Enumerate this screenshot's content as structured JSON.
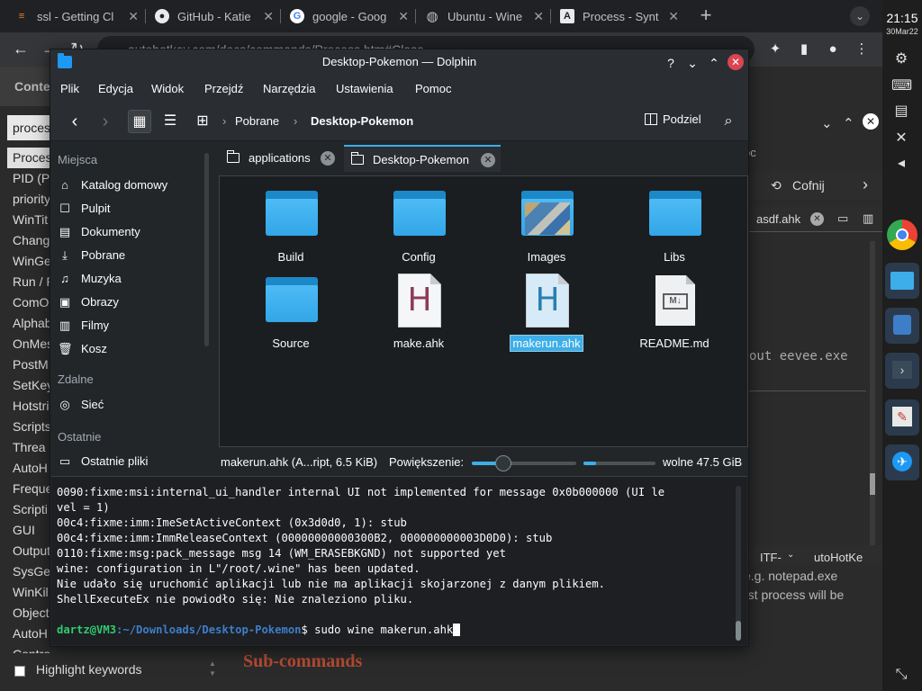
{
  "browser": {
    "tabs": [
      {
        "title": "ssl - Getting Cl",
        "icon": "stackoverflow-icon"
      },
      {
        "title": "GitHub - Katie",
        "icon": "github-icon"
      },
      {
        "title": "google - Goog",
        "icon": "google-icon"
      },
      {
        "title": "Ubuntu - Wine",
        "icon": "globe-icon"
      },
      {
        "title": "Process - Synt",
        "icon": "autohotkey-icon"
      }
    ],
    "url": "autohotkey.com/docs/commands/Process.htm#Close"
  },
  "webpage": {
    "left_header": "Conte",
    "search_value": "proces",
    "list": [
      "Proces",
      "PID (P",
      "priority",
      "WinTit",
      "Chang",
      "WinGe",
      "Run / R",
      "ComO",
      "Alphab",
      "OnMes",
      "PostM",
      "SetKey",
      "Hotstri",
      "Scripts",
      "Threa",
      "AutoH",
      "Freque",
      "Scripti",
      "GUI",
      "Output",
      "SysGe",
      "WinKil",
      "Object",
      "AutoH",
      "ControlGet"
    ],
    "highlight_label": "Highlight keywords",
    "subcommands": "Sub-commands",
    "right": {
      "oc": "oc",
      "undo": "Cofnij",
      "file_tab": "asdf.ahk",
      "code": "out eevee.exe",
      "encoding": "ITF-",
      "app": "utoHotKe",
      "doc1": "e.g. notepad.exe",
      "doc2": "rst process will be"
    }
  },
  "shelf": {
    "time": "21:15",
    "date": "30Mar22"
  },
  "dolphin": {
    "title": "Desktop-Pokemon — Dolphin",
    "menu": [
      "Plik",
      "Edycja",
      "Widok",
      "Przejdź",
      "Narzędzia",
      "Ustawienia",
      "Pomoc"
    ],
    "breadcrumb": [
      "Pobrane",
      "Desktop-Pokemon"
    ],
    "split_label": "Podziel",
    "places": {
      "group1": "Miejsca",
      "items1": [
        "Katalog domowy",
        "Pulpit",
        "Dokumenty",
        "Pobrane",
        "Muzyka",
        "Obrazy",
        "Filmy",
        "Kosz"
      ],
      "group2": "Zdalne",
      "items2": [
        "Sieć"
      ],
      "group3": "Ostatnie",
      "items3": [
        "Ostatnie pliki"
      ]
    },
    "view_tabs": [
      "applications",
      "Desktop-Pokemon"
    ],
    "files": [
      {
        "name": "Build",
        "type": "folder"
      },
      {
        "name": "Config",
        "type": "folder"
      },
      {
        "name": "Images",
        "type": "image-folder"
      },
      {
        "name": "Libs",
        "type": "folder"
      },
      {
        "name": "Source",
        "type": "folder"
      },
      {
        "name": "make.ahk",
        "type": "ahk"
      },
      {
        "name": "makerun.ahk",
        "type": "ahk",
        "selected": true
      },
      {
        "name": "README.md",
        "type": "markdown"
      }
    ],
    "status": {
      "selection": "makerun.ahk (A...ript, 6.5 KiB)",
      "zoom_label": "Powiększenie:",
      "zoom_level": 0.3,
      "disk_used": 0.18,
      "free": "wolne 47.5 GiB"
    },
    "terminal": {
      "lines": [
        "0090:fixme:msi:internal_ui_handler internal UI not implemented for message 0x0b000000 (UI le",
        "vel = 1)",
        "00c4:fixme:imm:ImeSetActiveContext (0x3d0d0, 1): stub",
        "00c4:fixme:imm:ImmReleaseContext (00000000000300B2, 000000000003D0D0): stub",
        "0110:fixme:msg:pack_message msg 14 (WM_ERASEBKGND) not supported yet",
        "wine: configuration in L\"/root/.wine\" has been updated.",
        "Nie udało się uruchomić aplikacji lub nie ma aplikacji skojarzonej z danym plikiem.",
        "ShellExecuteEx nie powiodło się: Nie znaleziono pliku."
      ],
      "prompt_user": "dartz@VM3",
      "prompt_path": ":~/Downloads/Desktop-Pokemon",
      "prompt_cmd": "$ sudo wine makerun.ahk"
    }
  },
  "colors": {
    "accent": "#3daee9",
    "close": "#da4453",
    "window_bg": "#232629"
  }
}
